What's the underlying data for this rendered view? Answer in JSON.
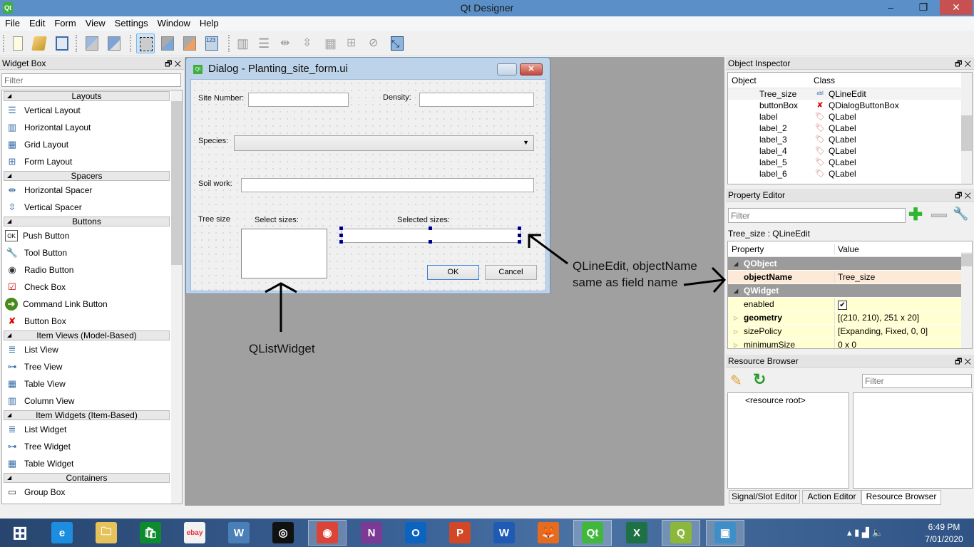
{
  "app": {
    "title": "Qt Designer"
  },
  "window_controls": {
    "minimize": "–",
    "restore": "❐",
    "close": "✕"
  },
  "menu": [
    "File",
    "Edit",
    "Form",
    "View",
    "Settings",
    "Window",
    "Help"
  ],
  "toolbar": [
    {
      "icon": "new-form-icon"
    },
    {
      "icon": "open-form-icon"
    },
    {
      "icon": "save-form-icon"
    },
    {
      "icon": "send-to-back-icon"
    },
    {
      "icon": "bring-to-front-icon"
    },
    {
      "icon": "edit-widgets-icon",
      "active": true
    },
    {
      "icon": "edit-signals-slots-icon"
    },
    {
      "icon": "edit-buddies-icon"
    },
    {
      "icon": "edit-tab-order-icon"
    },
    {
      "icon": "lay-out-horizontally-icon"
    },
    {
      "icon": "lay-out-vertically-icon"
    },
    {
      "icon": "lay-out-horizontal-splitter-icon"
    },
    {
      "icon": "lay-out-vertical-splitter-icon"
    },
    {
      "icon": "lay-out-grid-icon"
    },
    {
      "icon": "lay-out-form-icon"
    },
    {
      "icon": "break-layout-icon"
    },
    {
      "icon": "adjust-size-icon"
    }
  ],
  "widget_box": {
    "title": "Widget Box",
    "filter_placeholder": "Filter",
    "categories": [
      {
        "name": "Layouts",
        "items": [
          {
            "label": "Vertical Layout",
            "icon": "vertical-layout-icon",
            "glyph": "☰"
          },
          {
            "label": "Horizontal Layout",
            "icon": "horizontal-layout-icon",
            "glyph": "▥"
          },
          {
            "label": "Grid Layout",
            "icon": "grid-layout-icon",
            "glyph": "▦"
          },
          {
            "label": "Form Layout",
            "icon": "form-layout-icon",
            "glyph": "⊞"
          }
        ]
      },
      {
        "name": "Spacers",
        "items": [
          {
            "label": "Horizontal Spacer",
            "icon": "horizontal-spacer-icon",
            "glyph": "⇹"
          },
          {
            "label": "Vertical Spacer",
            "icon": "vertical-spacer-icon",
            "glyph": "⇳"
          }
        ]
      },
      {
        "name": "Buttons",
        "items": [
          {
            "label": "Push Button",
            "icon": "push-button-icon",
            "glyph": "OK"
          },
          {
            "label": "Tool Button",
            "icon": "tool-button-icon",
            "glyph": "🔧"
          },
          {
            "label": "Radio Button",
            "icon": "radio-button-icon",
            "glyph": "◉"
          },
          {
            "label": "Check Box",
            "icon": "check-box-icon",
            "glyph": "☑"
          },
          {
            "label": "Command Link Button",
            "icon": "command-link-icon",
            "glyph": "➔"
          },
          {
            "label": "Button Box",
            "icon": "button-box-icon",
            "glyph": "✘"
          }
        ]
      },
      {
        "name": "Item Views (Model-Based)",
        "items": [
          {
            "label": "List View",
            "icon": "list-view-icon",
            "glyph": "≣"
          },
          {
            "label": "Tree View",
            "icon": "tree-view-icon",
            "glyph": "⊶"
          },
          {
            "label": "Table View",
            "icon": "table-view-icon",
            "glyph": "▦"
          },
          {
            "label": "Column View",
            "icon": "column-view-icon",
            "glyph": "▥"
          }
        ]
      },
      {
        "name": "Item Widgets (Item-Based)",
        "items": [
          {
            "label": "List Widget",
            "icon": "list-widget-icon",
            "glyph": "≣"
          },
          {
            "label": "Tree Widget",
            "icon": "tree-widget-icon",
            "glyph": "⊶"
          },
          {
            "label": "Table Widget",
            "icon": "table-widget-icon",
            "glyph": "▦"
          }
        ]
      },
      {
        "name": "Containers",
        "items": [
          {
            "label": "Group Box",
            "icon": "group-box-icon",
            "glyph": "▭"
          }
        ]
      }
    ]
  },
  "dialog": {
    "title": "Dialog - Planting_site_form.ui",
    "labels": {
      "site_number": "Site Number:",
      "density": "Density:",
      "species": "Species:",
      "soil_work": "Soil work:",
      "tree_size": "Tree size",
      "select_sizes": "Select sizes:",
      "selected_sizes": "Selected sizes:"
    },
    "buttons": {
      "ok": "OK",
      "cancel": "Cancel"
    }
  },
  "annotations": {
    "list_widget_note": "QListWidget",
    "line_edit_note_1": "QLineEdit, objectName",
    "line_edit_note_2": "same as field name"
  },
  "object_inspector": {
    "title": "Object Inspector",
    "columns": [
      "Object",
      "Class"
    ],
    "rows": [
      {
        "object": "Tree_size",
        "class": "QLineEdit",
        "icon": "line-edit-icon",
        "selected": true
      },
      {
        "object": "buttonBox",
        "class": "QDialogButtonBox",
        "icon": "button-box-icon"
      },
      {
        "object": "label",
        "class": "QLabel",
        "icon": "label-icon"
      },
      {
        "object": "label_2",
        "class": "QLabel",
        "icon": "label-icon"
      },
      {
        "object": "label_3",
        "class": "QLabel",
        "icon": "label-icon"
      },
      {
        "object": "label_4",
        "class": "QLabel",
        "icon": "label-icon"
      },
      {
        "object": "label_5",
        "class": "QLabel",
        "icon": "label-icon"
      },
      {
        "object": "label_6",
        "class": "QLabel",
        "icon": "label-icon"
      }
    ]
  },
  "property_editor": {
    "title": "Property Editor",
    "filter_placeholder": "Filter",
    "context": "Tree_size : QLineEdit",
    "columns": [
      "Property",
      "Value"
    ],
    "rows": [
      {
        "type": "group",
        "property": "QObject"
      },
      {
        "type": "prop",
        "property": "objectName",
        "value": "Tree_size",
        "bold": true,
        "tone": "orange"
      },
      {
        "type": "group",
        "property": "QWidget"
      },
      {
        "type": "prop",
        "property": "enabled",
        "value": "✔",
        "checkbox": true,
        "tone": "yellow"
      },
      {
        "type": "prop",
        "property": "geometry",
        "value": "[(210, 210), 251 x 20]",
        "bold": true,
        "expandable": true,
        "tone": "yellow"
      },
      {
        "type": "prop",
        "property": "sizePolicy",
        "value": "[Expanding, Fixed, 0, 0]",
        "expandable": true,
        "tone": "yellow"
      },
      {
        "type": "prop",
        "property": "minimumSize",
        "value": "0 x 0",
        "expandable": true,
        "tone": "yellow"
      }
    ]
  },
  "resource_browser": {
    "title": "Resource Browser",
    "filter_placeholder": "Filter",
    "root": "<resource root>"
  },
  "bottom_tabs": [
    {
      "label": "Signal/Slot Editor",
      "active": false
    },
    {
      "label": "Action Editor",
      "active": false
    },
    {
      "label": "Resource Browser",
      "active": true
    }
  ],
  "taskbar": {
    "apps": [
      {
        "name": "start",
        "glyph": "⊞",
        "color": "transparent"
      },
      {
        "name": "internet-explorer",
        "glyph": "e",
        "color": "#1d8de0"
      },
      {
        "name": "file-explorer",
        "glyph": "🗀",
        "color": "#e6c25a"
      },
      {
        "name": "store",
        "glyph": "🛍",
        "color": "#0c8c2c"
      },
      {
        "name": "ebay",
        "glyph": "ebay",
        "color": "#f2f2f2"
      },
      {
        "name": "wing-ide",
        "glyph": "W",
        "color": "#4a7fb8"
      },
      {
        "name": "app-circle",
        "glyph": "◎",
        "color": "#111"
      },
      {
        "name": "chrome",
        "glyph": "◉",
        "color": "#db4437",
        "active": true
      },
      {
        "name": "onenote",
        "glyph": "N",
        "color": "#7b3a96"
      },
      {
        "name": "outlook",
        "glyph": "O",
        "color": "#0b64c0"
      },
      {
        "name": "powerpoint",
        "glyph": "P",
        "color": "#d24726"
      },
      {
        "name": "word",
        "glyph": "W",
        "color": "#1f5bb5"
      },
      {
        "name": "firefox",
        "glyph": "🦊",
        "color": "#e76b1f"
      },
      {
        "name": "qt-designer",
        "glyph": "Qt",
        "color": "#41b83c",
        "active": true
      },
      {
        "name": "excel",
        "glyph": "X",
        "color": "#1e7145"
      },
      {
        "name": "qgis",
        "glyph": "Q",
        "color": "#8bb83a",
        "active": true
      },
      {
        "name": "photos",
        "glyph": "▣",
        "color": "#3e8fc8",
        "active": true
      }
    ],
    "tray": "▴  ▮  ▟  🔈",
    "time": "6:49 PM",
    "date": "7/01/2020"
  }
}
